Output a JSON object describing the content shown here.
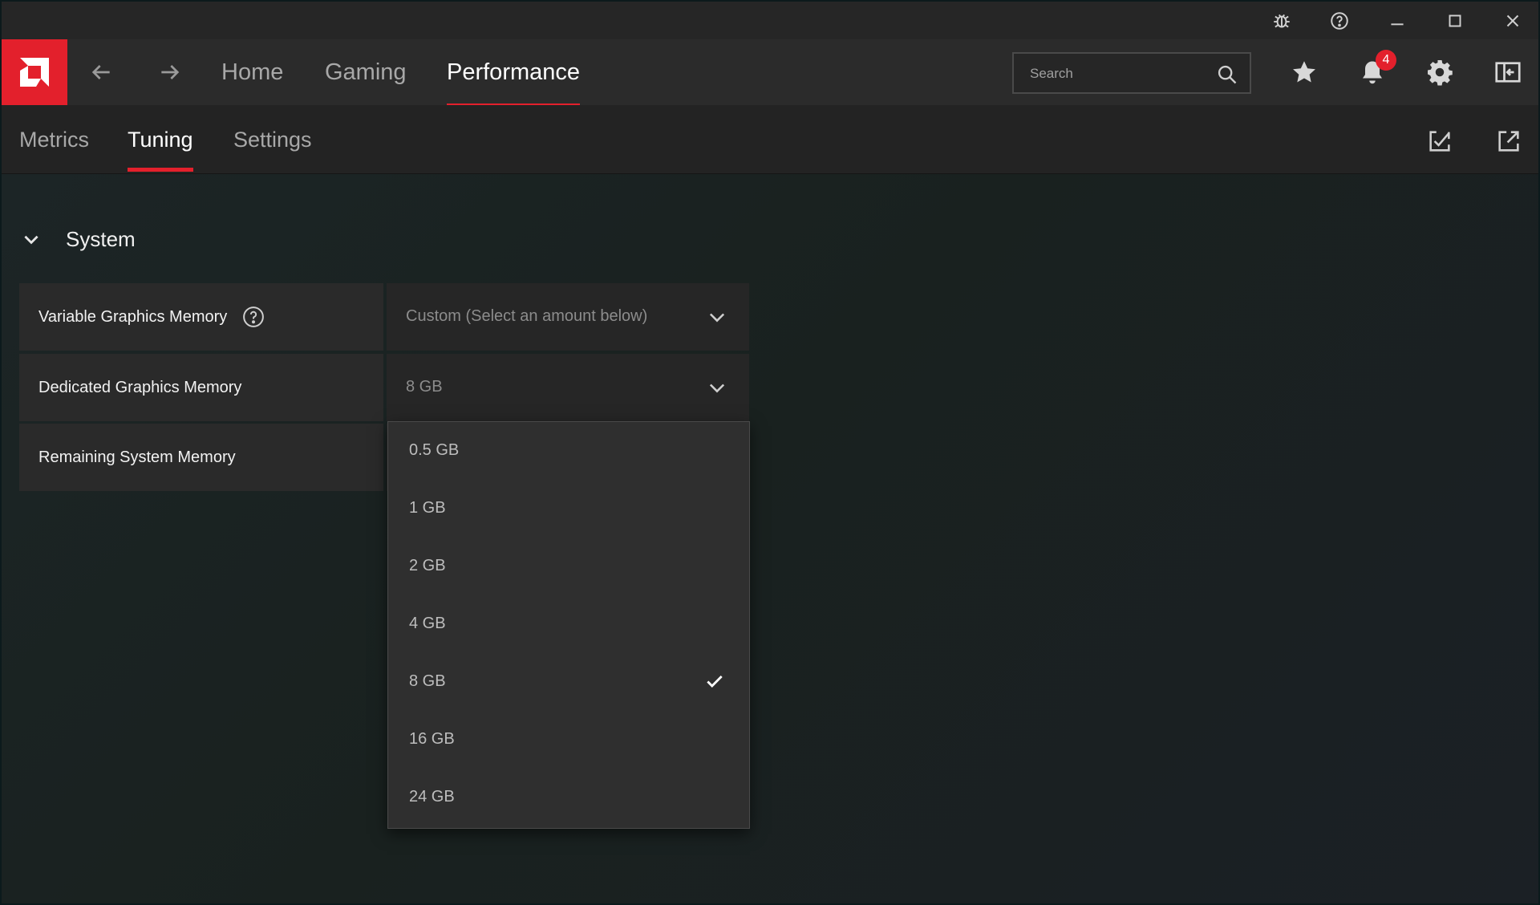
{
  "titlebar": {
    "icons": [
      "bug-report-icon",
      "help-icon",
      "minimize-icon",
      "maximize-icon",
      "close-icon"
    ]
  },
  "header": {
    "nav_tabs": [
      {
        "label": "Home",
        "active": false
      },
      {
        "label": "Gaming",
        "active": false
      },
      {
        "label": "Performance",
        "active": true
      }
    ],
    "search": {
      "placeholder": "Search"
    },
    "notification_count": "4",
    "accent_color": "#e3202c"
  },
  "subnav": {
    "tabs": [
      {
        "label": "Metrics",
        "active": false
      },
      {
        "label": "Tuning",
        "active": true
      },
      {
        "label": "Settings",
        "active": false
      }
    ]
  },
  "section": {
    "title": "System",
    "expanded": true
  },
  "settings": [
    {
      "label": "Variable Graphics Memory",
      "value": "Custom (Select an amount below)",
      "has_help": true
    },
    {
      "label": "Dedicated Graphics Memory",
      "value": "8 GB",
      "has_help": false
    },
    {
      "label": "Remaining System Memory",
      "value": "",
      "has_help": false
    }
  ],
  "dropdown": {
    "options": [
      "0.5 GB",
      "1 GB",
      "2 GB",
      "4 GB",
      "8 GB",
      "16 GB",
      "24 GB"
    ],
    "selected": "8 GB"
  }
}
